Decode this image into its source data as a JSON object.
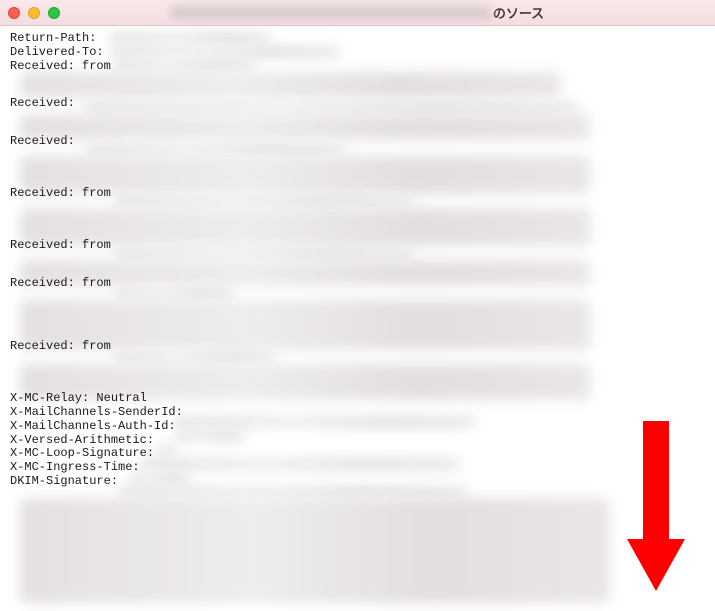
{
  "window": {
    "title_suffix": "のソース"
  },
  "headers": [
    {
      "label": "Return-Path:"
    },
    {
      "label": "Delivered-To:"
    },
    {
      "label": "Received: from"
    },
    {
      "label": "Received:"
    },
    {
      "label": "Received:"
    },
    {
      "label": "Received: from"
    },
    {
      "label": "Received: from"
    },
    {
      "label": "Received: from"
    },
    {
      "label": "Received: from"
    },
    {
      "label": "X-MC-Relay: Neutral"
    },
    {
      "label": "X-MailChannels-SenderId:"
    },
    {
      "label": "X-MailChannels-Auth-Id:"
    },
    {
      "label": "X-Versed-Arithmetic:"
    },
    {
      "label": "X-MC-Loop-Signature:"
    },
    {
      "label": "X-MC-Ingress-Time:"
    },
    {
      "label": "DKIM-Signature:"
    }
  ],
  "arrow": {
    "color": "#ff0000"
  }
}
